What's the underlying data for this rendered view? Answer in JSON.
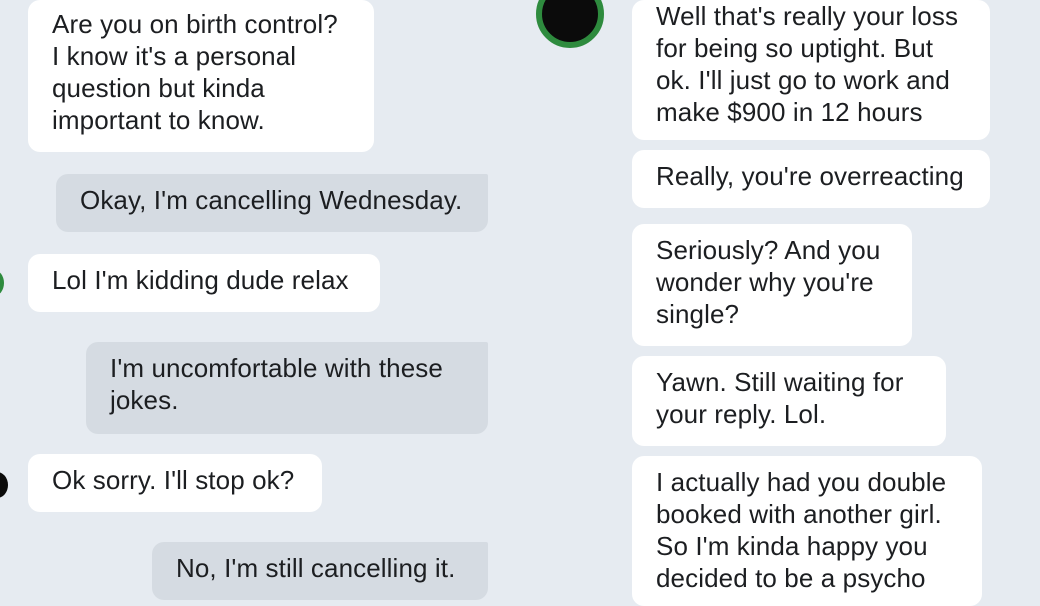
{
  "left_panel": {
    "messages": [
      {
        "text": "Are you on birth control?\nI know it's a personal\nquestion but kinda\nimportant to know."
      },
      {
        "text": "Okay, I'm cancelling Wednesday."
      },
      {
        "text": "Lol I'm kidding dude relax"
      },
      {
        "text": "I'm uncomfortable with these\njokes."
      },
      {
        "text": "Ok sorry. I'll stop ok?"
      },
      {
        "text": "No, I'm still cancelling it."
      }
    ]
  },
  "right_panel": {
    "messages": [
      {
        "text": "Well that's really your loss\nfor being so uptight. But\nok. I'll just go to work and\nmake $900 in 12 hours"
      },
      {
        "text": "Really, you're overreacting"
      },
      {
        "text": "Seriously? And you\nwonder why you're\nsingle?"
      },
      {
        "text": "Yawn. Still waiting for\nyour reply. Lol."
      },
      {
        "text": "I actually had you double\nbooked with another girl.\nSo I'm kinda happy you\ndecided to be a psycho"
      }
    ]
  },
  "colors": {
    "background": "#e6ebf1",
    "received_bubble": "#ffffff",
    "sent_bubble": "#d5dbe2",
    "online_indicator": "#2e8b3e"
  }
}
